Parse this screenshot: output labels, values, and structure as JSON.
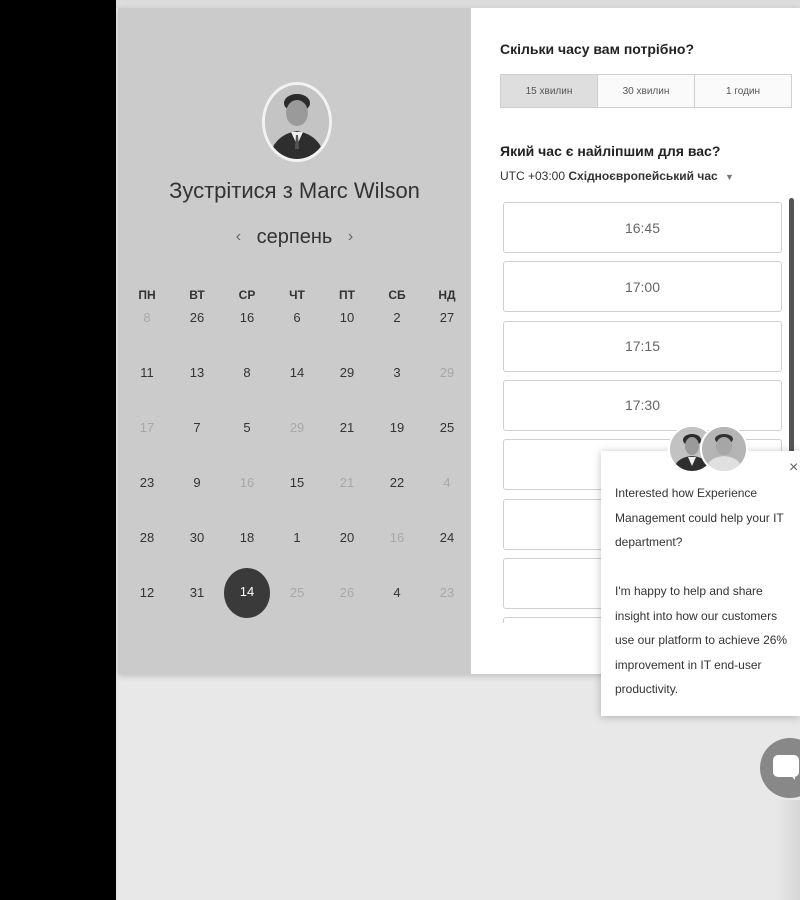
{
  "host": {
    "name": "Marc Wilson",
    "title_prefix": "Зустрітися з"
  },
  "calendar": {
    "month": "серпень",
    "prev_icon": "chevron-left-icon",
    "next_icon": "chevron-right-icon",
    "weekdays": [
      "ПН",
      "ВТ",
      "СР",
      "ЧТ",
      "ПТ",
      "СБ",
      "НД"
    ],
    "weeks": [
      [
        {
          "d": "8",
          "muted": true
        },
        {
          "d": "26",
          "muted": false
        },
        {
          "d": "16",
          "muted": false
        },
        {
          "d": "6",
          "muted": false
        },
        {
          "d": "10",
          "muted": false
        },
        {
          "d": "2",
          "muted": false
        },
        {
          "d": "27",
          "muted": false
        }
      ],
      [
        {
          "d": "11",
          "muted": false
        },
        {
          "d": "13",
          "muted": false
        },
        {
          "d": "8",
          "muted": false
        },
        {
          "d": "14",
          "muted": false
        },
        {
          "d": "29",
          "muted": false
        },
        {
          "d": "3",
          "muted": false
        },
        {
          "d": "29",
          "muted": true
        }
      ],
      [
        {
          "d": "17",
          "muted": true
        },
        {
          "d": "7",
          "muted": false
        },
        {
          "d": "5",
          "muted": false
        },
        {
          "d": "29",
          "muted": true
        },
        {
          "d": "21",
          "muted": false
        },
        {
          "d": "19",
          "muted": false
        },
        {
          "d": "25",
          "muted": false
        }
      ],
      [
        {
          "d": "23",
          "muted": false
        },
        {
          "d": "9",
          "muted": false
        },
        {
          "d": "16",
          "muted": true
        },
        {
          "d": "15",
          "muted": false
        },
        {
          "d": "21",
          "muted": true
        },
        {
          "d": "22",
          "muted": false
        },
        {
          "d": "4",
          "muted": true
        }
      ],
      [
        {
          "d": "28",
          "muted": false
        },
        {
          "d": "30",
          "muted": false
        },
        {
          "d": "18",
          "muted": false
        },
        {
          "d": "1",
          "muted": false
        },
        {
          "d": "20",
          "muted": false
        },
        {
          "d": "16",
          "muted": true
        },
        {
          "d": "24",
          "muted": false
        }
      ],
      [
        {
          "d": "12",
          "muted": false
        },
        {
          "d": "31",
          "muted": false
        },
        {
          "d": "14",
          "muted": false,
          "selected": true
        },
        {
          "d": "25",
          "muted": true
        },
        {
          "d": "26",
          "muted": true
        },
        {
          "d": "4",
          "muted": false
        },
        {
          "d": "23",
          "muted": true
        }
      ]
    ]
  },
  "duration": {
    "question": "Скільки часу вам потрібно?",
    "options": [
      "15 хвилин",
      "30 хвилин",
      "1 годин"
    ],
    "selected_index": 0
  },
  "time": {
    "question": "Який час є найліпшим для вас?",
    "tz_prefix": "UTC +03:00",
    "tz_name": "Східноєвропейський час",
    "tz_caret_icon": "caret-down-icon",
    "slots": [
      "16:45",
      "17:00",
      "17:15",
      "17:30",
      "",
      "",
      "",
      ""
    ]
  },
  "chat_popup": {
    "close_symbol": "×",
    "message": "Interested how Experience Management could help your IT department?\n\nI'm happy to help and share insight into how our customers use our platform to achieve 26% improvement in IT end-user productivity."
  },
  "colors": {
    "left_panel": "#cbcbcb",
    "selected_day": "#3a3a3a",
    "chat_button": "#888888"
  }
}
